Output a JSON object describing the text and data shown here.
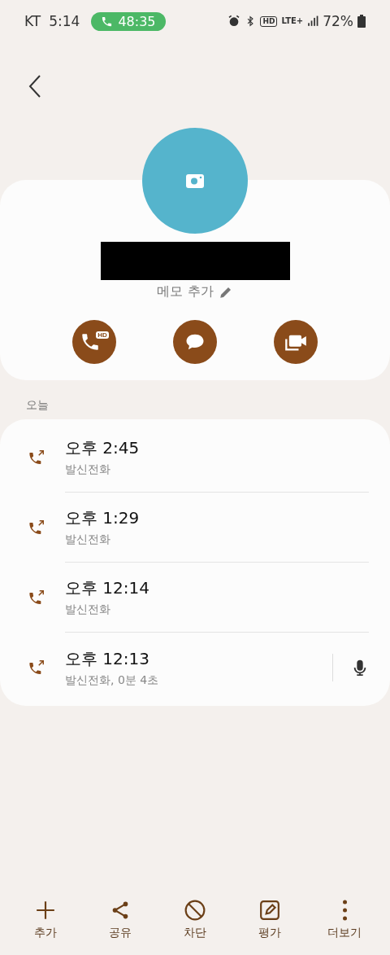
{
  "status_bar": {
    "carrier": "KT",
    "time": "5:14",
    "call_timer": "48:35",
    "hd_badge": "HD",
    "network": "LTE+",
    "battery": "72%"
  },
  "contact": {
    "memo": "메모 추가",
    "actions": [
      {
        "kind": "voice_call",
        "badge": "HD"
      },
      {
        "kind": "message"
      },
      {
        "kind": "video_call"
      }
    ]
  },
  "section_label": "오늘",
  "calls": [
    {
      "time": "오후 2:45",
      "detail": "발신전화",
      "recording": false
    },
    {
      "time": "오후 1:29",
      "detail": "발신전화",
      "recording": false
    },
    {
      "time": "오후 12:14",
      "detail": "발신전화",
      "recording": false
    },
    {
      "time": "오후 12:13",
      "detail": "발신전화, 0분 4초",
      "recording": true
    }
  ],
  "bottom_nav": [
    {
      "kind": "add",
      "label": "추가"
    },
    {
      "kind": "share",
      "label": "공유"
    },
    {
      "kind": "block",
      "label": "차단"
    },
    {
      "kind": "rate",
      "label": "평가"
    },
    {
      "kind": "more",
      "label": "더보기"
    }
  ]
}
